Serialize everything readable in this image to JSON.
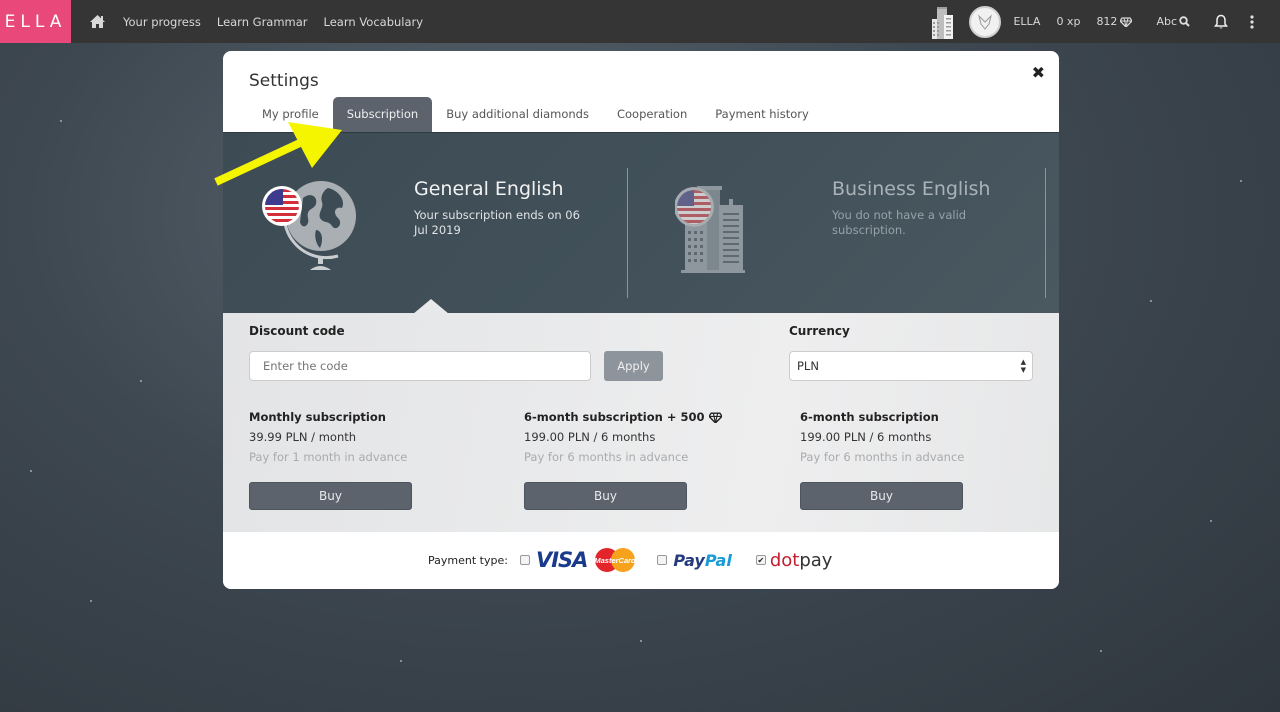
{
  "topbar": {
    "logo": "ELLA",
    "nav": [
      "Your progress",
      "Learn Grammar",
      "Learn Vocabulary"
    ],
    "username": "ELLA",
    "xp": "0 xp",
    "diamonds": "812",
    "dictionary_label": "Abc"
  },
  "modal": {
    "title": "Settings",
    "close_symbol": "✖",
    "tabs": [
      {
        "label": "My profile",
        "active": false
      },
      {
        "label": "Subscription",
        "active": true
      },
      {
        "label": "Buy additional diamonds",
        "active": false
      },
      {
        "label": "Cooperation",
        "active": false
      },
      {
        "label": "Payment history",
        "active": false
      }
    ],
    "courses": [
      {
        "title": "General English",
        "status": "Your subscription ends on 06 Jul 2019",
        "active": true
      },
      {
        "title": "Business English",
        "status": "You do not have a valid subscription.",
        "active": false
      }
    ],
    "discount": {
      "label": "Discount code",
      "placeholder": "Enter the code",
      "value": "",
      "apply_label": "Apply"
    },
    "currency": {
      "label": "Currency",
      "selected": "PLN"
    },
    "plans": [
      {
        "name": "Monthly subscription",
        "price": "39.99 PLN / month",
        "note": "Pay for 1 month in advance",
        "buy_label": "Buy"
      },
      {
        "name": "6-month subscription + 500",
        "price": "199.00 PLN / 6 months",
        "note": "Pay for 6 months in advance",
        "buy_label": "Buy",
        "bonus_icon": "diamond-icon"
      },
      {
        "name": "6-month subscription",
        "price": "199.00 PLN / 6 months",
        "note": "Pay for 6 months in advance",
        "buy_label": "Buy"
      }
    ],
    "payment": {
      "label": "Payment type:",
      "options": [
        {
          "name": "VISA / MasterCard",
          "visa_text": "VISA",
          "mc_text": "MasterCard",
          "checked": false
        },
        {
          "name": "PayPal",
          "text_a": "Pay",
          "text_b": "Pal",
          "checked": false
        },
        {
          "name": "dotpay",
          "text_a": "dot",
          "text_b": "pay",
          "checked": true
        }
      ]
    }
  },
  "annotation": {
    "color": "#f5f500",
    "points_to": "Subscription"
  }
}
